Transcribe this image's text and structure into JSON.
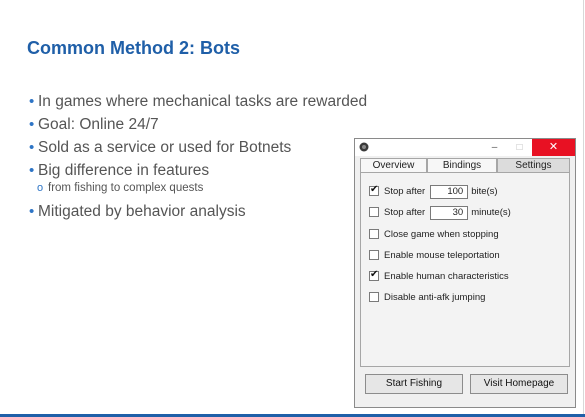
{
  "slide": {
    "title": "Common Method 2: Bots",
    "bullets": [
      "In games where mechanical tasks are rewarded",
      "Goal: Online 24/7",
      "Sold as a service or used for Botnets",
      "Big difference in features",
      "Mitigated by behavior analysis"
    ],
    "sub_bullet": "from fishing to complex quests",
    "accent_color": "#1f5fa8"
  },
  "window": {
    "controls": {
      "minimize": "–",
      "maximize": "□",
      "close": "✕"
    },
    "tabs": [
      "Overview",
      "Bindings",
      "Settings"
    ],
    "active_tab": "Settings",
    "options": [
      {
        "label": "Stop after",
        "checked": true,
        "value": "100",
        "unit": "bite(s)"
      },
      {
        "label": "Stop after",
        "checked": false,
        "value": "30",
        "unit": "minute(s)"
      },
      {
        "label": "Close game when stopping",
        "checked": false
      },
      {
        "label": "Enable mouse teleportation",
        "checked": false
      },
      {
        "label": "Enable human characteristics",
        "checked": true
      },
      {
        "label": "Disable anti-afk jumping",
        "checked": false
      }
    ],
    "buttons": {
      "start": "Start Fishing",
      "homepage": "Visit Homepage"
    }
  }
}
